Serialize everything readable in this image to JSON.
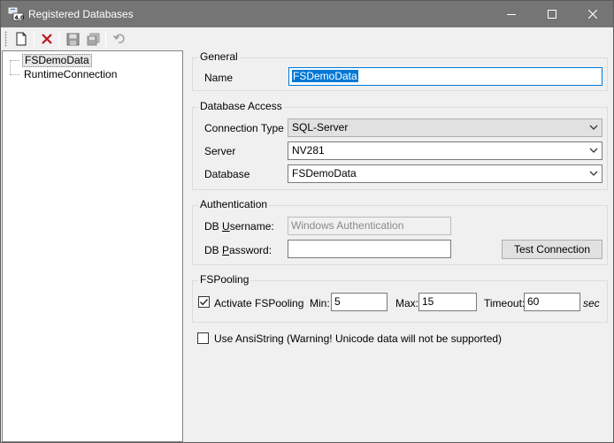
{
  "window": {
    "title": "Registered Databases",
    "icon": "database-app-icon"
  },
  "toolbar": {
    "buttons": [
      {
        "name": "new-icon"
      },
      {
        "name": "delete-icon"
      },
      {
        "name": "save-icon"
      },
      {
        "name": "save-all-icon"
      },
      {
        "name": "undo-icon"
      }
    ]
  },
  "tree": {
    "items": [
      {
        "label": "FSDemoData",
        "selected": true
      },
      {
        "label": "RuntimeConnection",
        "selected": false
      }
    ]
  },
  "general": {
    "title": "General",
    "name_label": "Name",
    "name_value": "FSDemoData"
  },
  "database_access": {
    "title": "Database Access",
    "connection_type_label": "Connection Type",
    "connection_type_value": "SQL-Server",
    "server_label": "Server",
    "server_value": "NV281",
    "database_label": "Database",
    "database_value": "FSDemoData"
  },
  "authentication": {
    "title": "Authentication",
    "username_label_pre": "DB ",
    "username_label_u": "U",
    "username_label_post": "sername:",
    "username_value": "Windows Authentication",
    "password_label_pre": "DB ",
    "password_label_u": "P",
    "password_label_post": "assword:",
    "password_value": "",
    "test_button": "Test Connection"
  },
  "pooling": {
    "title": "FSPooling",
    "activate_label": "Activate FSPooling",
    "activate_checked": true,
    "min_label": "Min:",
    "min_value": "5",
    "max_label": "Max:",
    "max_value": "15",
    "timeout_label": "Timeout:",
    "timeout_value": "60",
    "timeout_unit": "sec"
  },
  "ansi": {
    "label": "Use AnsiString (Warning! Unicode data will not be supported)",
    "checked": false
  },
  "colors": {
    "accent": "#0078d7",
    "titlebar": "#757575"
  }
}
